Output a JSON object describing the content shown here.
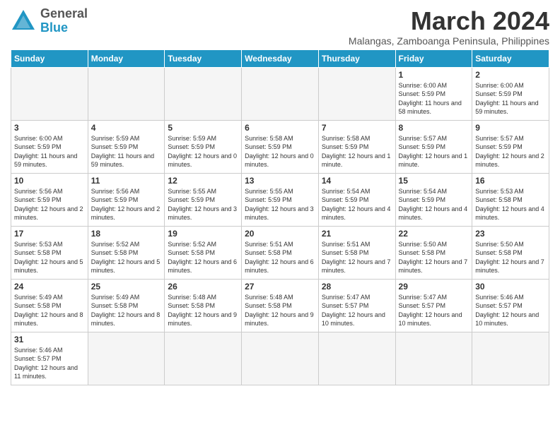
{
  "header": {
    "logo_general": "General",
    "logo_blue": "Blue",
    "month_title": "March 2024",
    "subtitle": "Malangas, Zamboanga Peninsula, Philippines"
  },
  "weekdays": [
    "Sunday",
    "Monday",
    "Tuesday",
    "Wednesday",
    "Thursday",
    "Friday",
    "Saturday"
  ],
  "weeks": [
    [
      {
        "day": "",
        "info": ""
      },
      {
        "day": "",
        "info": ""
      },
      {
        "day": "",
        "info": ""
      },
      {
        "day": "",
        "info": ""
      },
      {
        "day": "",
        "info": ""
      },
      {
        "day": "1",
        "info": "Sunrise: 6:00 AM\nSunset: 5:59 PM\nDaylight: 11 hours\nand 58 minutes."
      },
      {
        "day": "2",
        "info": "Sunrise: 6:00 AM\nSunset: 5:59 PM\nDaylight: 11 hours\nand 59 minutes."
      }
    ],
    [
      {
        "day": "3",
        "info": "Sunrise: 6:00 AM\nSunset: 5:59 PM\nDaylight: 11 hours\nand 59 minutes."
      },
      {
        "day": "4",
        "info": "Sunrise: 5:59 AM\nSunset: 5:59 PM\nDaylight: 11 hours\nand 59 minutes."
      },
      {
        "day": "5",
        "info": "Sunrise: 5:59 AM\nSunset: 5:59 PM\nDaylight: 12 hours\nand 0 minutes."
      },
      {
        "day": "6",
        "info": "Sunrise: 5:58 AM\nSunset: 5:59 PM\nDaylight: 12 hours\nand 0 minutes."
      },
      {
        "day": "7",
        "info": "Sunrise: 5:58 AM\nSunset: 5:59 PM\nDaylight: 12 hours\nand 1 minute."
      },
      {
        "day": "8",
        "info": "Sunrise: 5:57 AM\nSunset: 5:59 PM\nDaylight: 12 hours\nand 1 minute."
      },
      {
        "day": "9",
        "info": "Sunrise: 5:57 AM\nSunset: 5:59 PM\nDaylight: 12 hours\nand 2 minutes."
      }
    ],
    [
      {
        "day": "10",
        "info": "Sunrise: 5:56 AM\nSunset: 5:59 PM\nDaylight: 12 hours\nand 2 minutes."
      },
      {
        "day": "11",
        "info": "Sunrise: 5:56 AM\nSunset: 5:59 PM\nDaylight: 12 hours\nand 2 minutes."
      },
      {
        "day": "12",
        "info": "Sunrise: 5:55 AM\nSunset: 5:59 PM\nDaylight: 12 hours\nand 3 minutes."
      },
      {
        "day": "13",
        "info": "Sunrise: 5:55 AM\nSunset: 5:59 PM\nDaylight: 12 hours\nand 3 minutes."
      },
      {
        "day": "14",
        "info": "Sunrise: 5:54 AM\nSunset: 5:59 PM\nDaylight: 12 hours\nand 4 minutes."
      },
      {
        "day": "15",
        "info": "Sunrise: 5:54 AM\nSunset: 5:59 PM\nDaylight: 12 hours\nand 4 minutes."
      },
      {
        "day": "16",
        "info": "Sunrise: 5:53 AM\nSunset: 5:58 PM\nDaylight: 12 hours\nand 4 minutes."
      }
    ],
    [
      {
        "day": "17",
        "info": "Sunrise: 5:53 AM\nSunset: 5:58 PM\nDaylight: 12 hours\nand 5 minutes."
      },
      {
        "day": "18",
        "info": "Sunrise: 5:52 AM\nSunset: 5:58 PM\nDaylight: 12 hours\nand 5 minutes."
      },
      {
        "day": "19",
        "info": "Sunrise: 5:52 AM\nSunset: 5:58 PM\nDaylight: 12 hours\nand 6 minutes."
      },
      {
        "day": "20",
        "info": "Sunrise: 5:51 AM\nSunset: 5:58 PM\nDaylight: 12 hours\nand 6 minutes."
      },
      {
        "day": "21",
        "info": "Sunrise: 5:51 AM\nSunset: 5:58 PM\nDaylight: 12 hours\nand 7 minutes."
      },
      {
        "day": "22",
        "info": "Sunrise: 5:50 AM\nSunset: 5:58 PM\nDaylight: 12 hours\nand 7 minutes."
      },
      {
        "day": "23",
        "info": "Sunrise: 5:50 AM\nSunset: 5:58 PM\nDaylight: 12 hours\nand 7 minutes."
      }
    ],
    [
      {
        "day": "24",
        "info": "Sunrise: 5:49 AM\nSunset: 5:58 PM\nDaylight: 12 hours\nand 8 minutes."
      },
      {
        "day": "25",
        "info": "Sunrise: 5:49 AM\nSunset: 5:58 PM\nDaylight: 12 hours\nand 8 minutes."
      },
      {
        "day": "26",
        "info": "Sunrise: 5:48 AM\nSunset: 5:58 PM\nDaylight: 12 hours\nand 9 minutes."
      },
      {
        "day": "27",
        "info": "Sunrise: 5:48 AM\nSunset: 5:58 PM\nDaylight: 12 hours\nand 9 minutes."
      },
      {
        "day": "28",
        "info": "Sunrise: 5:47 AM\nSunset: 5:57 PM\nDaylight: 12 hours\nand 10 minutes."
      },
      {
        "day": "29",
        "info": "Sunrise: 5:47 AM\nSunset: 5:57 PM\nDaylight: 12 hours\nand 10 minutes."
      },
      {
        "day": "30",
        "info": "Sunrise: 5:46 AM\nSunset: 5:57 PM\nDaylight: 12 hours\nand 10 minutes."
      }
    ],
    [
      {
        "day": "31",
        "info": "Sunrise: 5:46 AM\nSunset: 5:57 PM\nDaylight: 12 hours\nand 11 minutes."
      },
      {
        "day": "",
        "info": ""
      },
      {
        "day": "",
        "info": ""
      },
      {
        "day": "",
        "info": ""
      },
      {
        "day": "",
        "info": ""
      },
      {
        "day": "",
        "info": ""
      },
      {
        "day": "",
        "info": ""
      }
    ]
  ]
}
